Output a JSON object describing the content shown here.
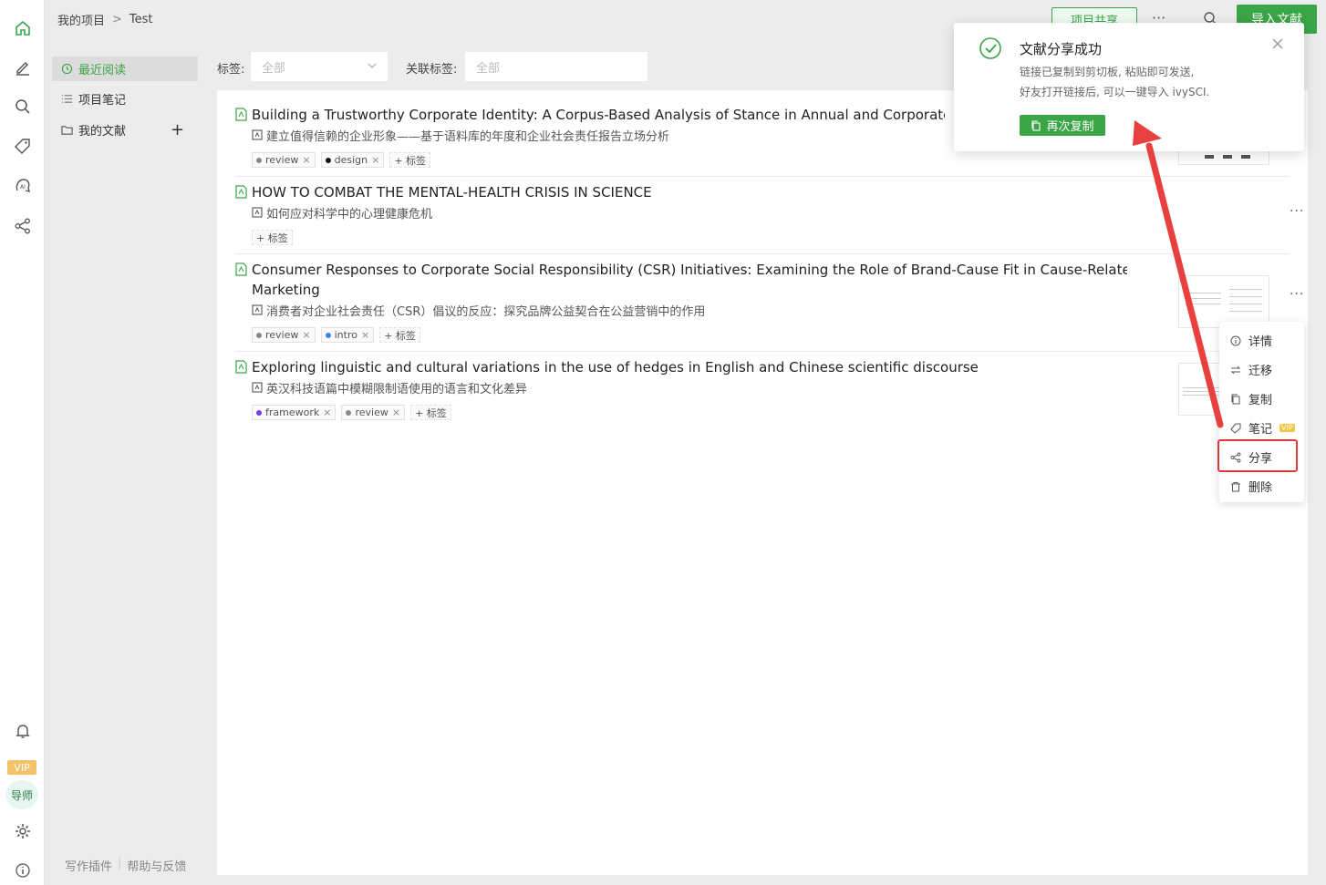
{
  "breadcrumb": {
    "root": "我的项目",
    "current": "Test"
  },
  "topbar": {
    "share_project": "项目共享",
    "more": "···",
    "import": "导入文献"
  },
  "rail": {
    "vip": "VIP",
    "mentor": "导师"
  },
  "side": {
    "items": [
      {
        "label": "最近阅读",
        "icon": "clock-icon"
      },
      {
        "label": "项目笔记",
        "icon": "list-icon"
      },
      {
        "label": "我的文献",
        "icon": "folder-icon"
      }
    ],
    "add": "+",
    "footer": {
      "plugin": "写作插件",
      "sep": "|",
      "help": "帮助与反馈"
    }
  },
  "filters": {
    "tag_label": "标签:",
    "tag_value": "全部",
    "rel_label": "关联标签:",
    "rel_value": "全部"
  },
  "entries": [
    {
      "title": "Building a Trustworthy Corporate Identity: A Corpus-Based Analysis of Stance in Annual and Corporate Soc",
      "subtitle": "建立值得信赖的企业形象——基于语料库的年度和企业社会责任报告立场分析",
      "tags": [
        {
          "name": "review",
          "color": "#888888"
        },
        {
          "name": "design",
          "color": "#111111"
        }
      ]
    },
    {
      "title": "HOW TO COMBAT THE MENTAL-HEALTH CRISIS IN SCIENCE",
      "subtitle": "如何应对科学中的心理健康危机",
      "tags": []
    },
    {
      "title": "Consumer Responses to Corporate Social Responsibility (CSR) Initiatives: Examining the Role of Brand-Cause Fit in Cause-Related",
      "title2": "Marketing",
      "subtitle": "消费者对企业社会责任（CSR）倡议的反应：探究品牌公益契合在公益营销中的作用",
      "tags": [
        {
          "name": "review",
          "color": "#888888"
        },
        {
          "name": "intro",
          "color": "#3b82f6"
        }
      ]
    },
    {
      "title": "Exploring linguistic and cultural variations in the use of hedges in English and Chinese scientific discourse",
      "subtitle": "英汉科技语篇中模糊限制语使用的语言和文化差异",
      "tags": [
        {
          "name": "framework",
          "color": "#7c3aed"
        },
        {
          "name": "review",
          "color": "#888888"
        }
      ]
    }
  ],
  "tag_add": "+ 标签",
  "tag_x": "×",
  "more": "···",
  "menu": {
    "details": "详情",
    "move": "迁移",
    "copy": "复制",
    "note": "笔记",
    "vip": "VIP",
    "share": "分享",
    "delete": "删除"
  },
  "toast": {
    "title": "文献分享成功",
    "line1": "链接已复制到剪切板, 粘贴即可发送,",
    "line2": "好友打开链接后, 可以一键导入 ivySCI.",
    "button": "再次复制"
  },
  "colors": {
    "accent": "#3aa547",
    "highlight": "#e03b3b"
  }
}
